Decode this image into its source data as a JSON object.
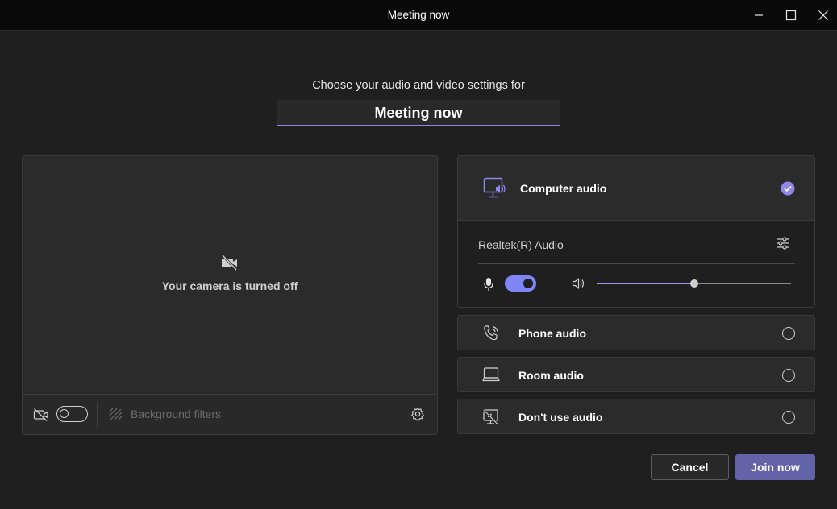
{
  "window": {
    "title": "Meeting now",
    "controls": [
      "minimize",
      "maximize",
      "close"
    ]
  },
  "header": {
    "subtitle": "Choose your audio and video settings for",
    "meeting_name": "Meeting now"
  },
  "video": {
    "camera_status": "Your camera is turned off",
    "camera_toggle_on": false,
    "background_filters_label": "Background filters"
  },
  "audio": {
    "selected_option": {
      "label": "Computer audio",
      "checked": true
    },
    "device_name": "Realtek(R) Audio",
    "mic_on": true,
    "volume_fraction": 0.5,
    "options": [
      {
        "label": "Phone audio",
        "icon": "phone-icon"
      },
      {
        "label": "Room audio",
        "icon": "room-icon"
      },
      {
        "label": "Don't use audio",
        "icon": "no-audio-icon"
      }
    ]
  },
  "footer": {
    "cancel_label": "Cancel",
    "join_label": "Join now"
  },
  "colors": {
    "accent": "#7f85f5",
    "join_button": "#6264a7",
    "background": "#1f1f1f"
  }
}
